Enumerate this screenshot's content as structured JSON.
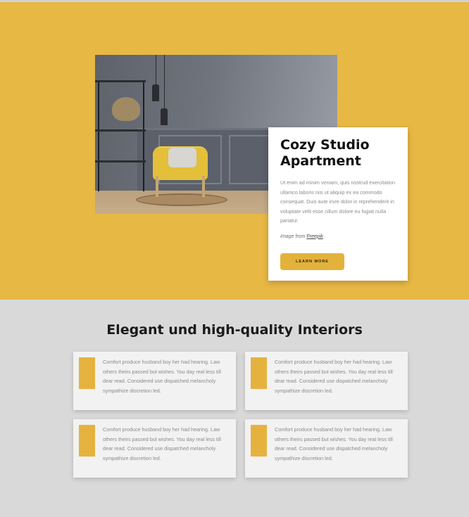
{
  "hero": {
    "background_color": "#e8b845",
    "photo": {
      "description_icon": "interior-photo-icon"
    },
    "card": {
      "title": "Cozy Studio Apartment",
      "body": "Ut enim ad minim veniam, quis nostrud exercitation ullamco laboris nisi ut aliquip ex ea commodo consequat. Duis aute irure dolor in reprehenderit in voluptate velit esse cillum dolore eu fugiat nulla pariatur.",
      "credit_prefix": "Image from ",
      "credit_link": "Freepik",
      "button_label": "LEARN MORE",
      "button_color": "#e3b23b"
    }
  },
  "features_section": {
    "title": "Elegant und high-quality Interiors",
    "accent_color": "#e6b23f",
    "items": [
      {
        "text": "Comfort produce husband boy her had hearing. Law others theirs passed but wishes. You day real less till dear read. Considered use dispatched melancholy sympathize discretion led."
      },
      {
        "text": "Comfort produce husband boy her had hearing. Law others theirs passed but wishes. You day real less till dear read. Considered use dispatched melancholy sympathize discretion led."
      },
      {
        "text": "Comfort produce husband boy her had hearing. Law others theirs passed but wishes. You day real less till dear read. Considered use dispatched melancholy sympathize discretion led."
      },
      {
        "text": "Comfort produce husband boy her had hearing. Law others theirs passed but wishes. You day real less till dear read. Considered use dispatched melancholy sympathize discretion led."
      }
    ]
  }
}
